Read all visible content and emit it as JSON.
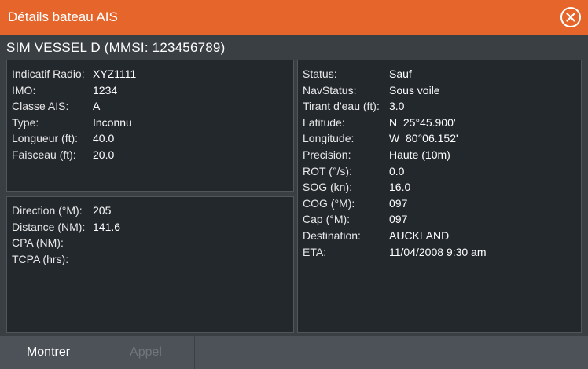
{
  "window": {
    "title": "Détails bateau AIS"
  },
  "vessel": {
    "title": "SIM VESSEL D (MMSI: 123456789)"
  },
  "identity": [
    {
      "label": "Indicatif Radio:",
      "value": "XYZ1111"
    },
    {
      "label": "IMO:",
      "value": "1234"
    },
    {
      "label": "Classe AIS:",
      "value": "A"
    },
    {
      "label": "Type:",
      "value": "Inconnu"
    },
    {
      "label": "Longueur (ft):",
      "value": "40.0"
    },
    {
      "label": "Faisceau (ft):",
      "value": "20.0"
    }
  ],
  "navigation": [
    {
      "label": "Direction (°M):",
      "value": "205"
    },
    {
      "label": "Distance (NM):",
      "value": "141.6"
    },
    {
      "label": "CPA (NM):",
      "value": ""
    },
    {
      "label": "TCPA (hrs):",
      "value": ""
    }
  ],
  "status": [
    {
      "label": "Status:",
      "value": "Sauf"
    },
    {
      "label": "NavStatus:",
      "value": "Sous voile"
    },
    {
      "label": "Tirant d'eau (ft):",
      "value": "3.0"
    },
    {
      "label": "Latitude:",
      "value": "N  25°45.900'"
    },
    {
      "label": "Longitude:",
      "value": "W  80°06.152'"
    },
    {
      "label": "Precision:",
      "value": "Haute (10m)"
    },
    {
      "label": "ROT (°/s):",
      "value": "0.0"
    },
    {
      "label": "SOG (kn):",
      "value": "16.0"
    },
    {
      "label": "COG (°M):",
      "value": "097"
    },
    {
      "label": "Cap (°M):",
      "value": "097"
    },
    {
      "label": "Destination:",
      "value": "AUCKLAND"
    },
    {
      "label": "ETA:",
      "value": "11/04/2008 9:30 am"
    }
  ],
  "footer": {
    "show_label": "Montrer",
    "call_label": "Appel"
  },
  "icons": {
    "close": "close-circle-icon"
  },
  "colors": {
    "titlebar": "#e5652a",
    "panel": "#23282d",
    "footer": "#4c5258",
    "disabled_text": "#6f767c"
  }
}
